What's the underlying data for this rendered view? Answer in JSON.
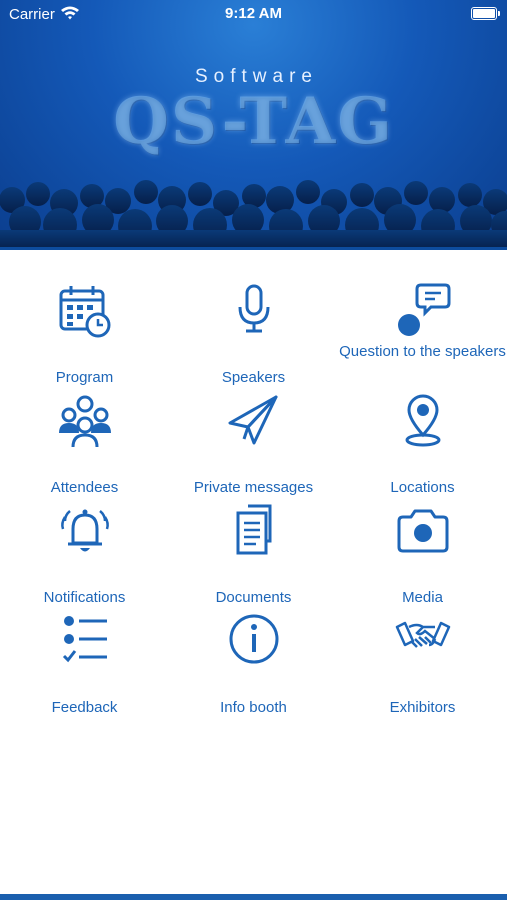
{
  "status_bar": {
    "carrier": "Carrier",
    "time": "9:12 AM"
  },
  "header": {
    "subtitle": "Software",
    "title": "QS-TAG"
  },
  "menu": [
    {
      "label": "Program",
      "icon": "calendar-clock-icon"
    },
    {
      "label": "Speakers",
      "icon": "microphone-icon"
    },
    {
      "label": "Question to the speakers",
      "icon": "question-chat-icon"
    },
    {
      "label": "Attendees",
      "icon": "people-icon"
    },
    {
      "label": "Private messages",
      "icon": "paper-plane-icon"
    },
    {
      "label": "Locations",
      "icon": "location-pin-icon"
    },
    {
      "label": "Notifications",
      "icon": "bell-icon"
    },
    {
      "label": "Documents",
      "icon": "documents-icon"
    },
    {
      "label": "Media",
      "icon": "camera-icon"
    },
    {
      "label": "Feedback",
      "icon": "checklist-icon"
    },
    {
      "label": "Info booth",
      "icon": "info-icon"
    },
    {
      "label": "Exhibitors",
      "icon": "handshake-icon"
    }
  ],
  "colors": {
    "accent": "#1e66b8",
    "header_bg": "#1459b8"
  }
}
